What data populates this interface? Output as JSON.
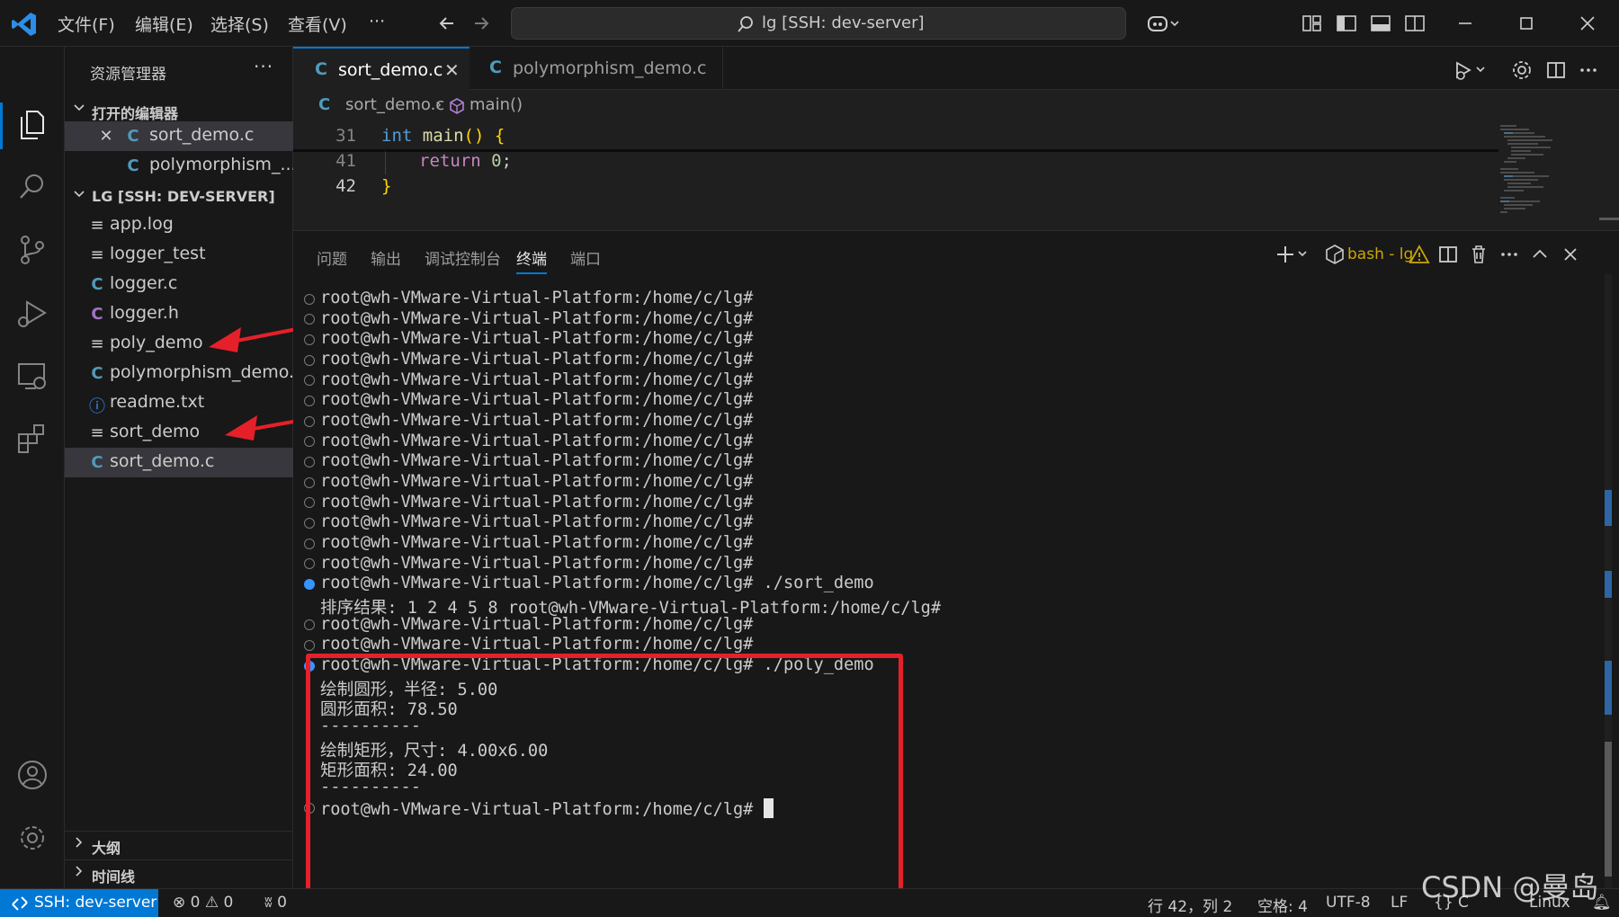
{
  "titlebar": {
    "menus": [
      "文件(F)",
      "编辑(E)",
      "选择(S)",
      "查看(V)",
      "···"
    ],
    "search_text": "lg [SSH: dev-server]"
  },
  "sidebar": {
    "title": "资源管理器",
    "more": "···",
    "open_editors_header": "打开的编辑器",
    "open_editors": [
      {
        "name": "sort_demo.c",
        "icon": "C",
        "close": "✕"
      },
      {
        "name": "polymorphism_...",
        "icon": "C"
      }
    ],
    "folder_header": "LG [SSH: DEV-SERVER]",
    "files": [
      {
        "name": "app.log",
        "icon": "≡"
      },
      {
        "name": "logger_test",
        "icon": "≡"
      },
      {
        "name": "logger.c",
        "icon": "C"
      },
      {
        "name": "logger.h",
        "icon": "C"
      },
      {
        "name": "poly_demo",
        "icon": "≡"
      },
      {
        "name": "polymorphism_demo.c",
        "icon": "C"
      },
      {
        "name": "readme.txt",
        "icon": "ⓘ"
      },
      {
        "name": "sort_demo",
        "icon": "≡"
      },
      {
        "name": "sort_demo.c",
        "icon": "C"
      }
    ],
    "outline_header": "大纲",
    "timeline_header": "时间线"
  },
  "tabs": [
    {
      "name": "sort_demo.c",
      "icon": "C",
      "close": "✕"
    },
    {
      "name": "polymorphism_demo.c",
      "icon": "C"
    }
  ],
  "breadcrumb": {
    "icon": "C",
    "file": "sort_demo.c",
    "sep": "›",
    "symbol": "main()"
  },
  "code": {
    "lines": [
      {
        "num": "31",
        "parts": {
          "kw": "int",
          "fn": "main",
          "rest": "() {"
        }
      },
      {
        "num": "41",
        "parts": {
          "ctl": "return",
          "num": "0",
          "end": ";"
        }
      },
      {
        "num": "42",
        "parts": {
          "br": "}"
        }
      }
    ]
  },
  "panel": {
    "tabs": [
      "问题",
      "输出",
      "调试控制台",
      "终端",
      "端口"
    ],
    "active_tab": "终端",
    "terminal_name": "bash - lg",
    "terminal_lines": [
      "root@wh-VMware-Virtual-Platform:/home/c/lg#",
      "root@wh-VMware-Virtual-Platform:/home/c/lg#",
      "root@wh-VMware-Virtual-Platform:/home/c/lg#",
      "root@wh-VMware-Virtual-Platform:/home/c/lg#",
      "root@wh-VMware-Virtual-Platform:/home/c/lg#",
      "root@wh-VMware-Virtual-Platform:/home/c/lg#",
      "root@wh-VMware-Virtual-Platform:/home/c/lg#",
      "root@wh-VMware-Virtual-Platform:/home/c/lg#",
      "root@wh-VMware-Virtual-Platform:/home/c/lg#",
      "root@wh-VMware-Virtual-Platform:/home/c/lg#",
      "root@wh-VMware-Virtual-Platform:/home/c/lg#",
      "root@wh-VMware-Virtual-Platform:/home/c/lg#",
      "root@wh-VMware-Virtual-Platform:/home/c/lg#",
      "root@wh-VMware-Virtual-Platform:/home/c/lg#",
      "root@wh-VMware-Virtual-Platform:/home/c/lg# ./sort_demo",
      "排序结果: 1 2 4 5 8 root@wh-VMware-Virtual-Platform:/home/c/lg#",
      "root@wh-VMware-Virtual-Platform:/home/c/lg#",
      "root@wh-VMware-Virtual-Platform:/home/c/lg#",
      "root@wh-VMware-Virtual-Platform:/home/c/lg# ./poly_demo",
      "绘制圆形，半径: 5.00",
      "圆形面积: 78.50",
      "----------",
      "绘制矩形，尺寸: 4.00x6.00",
      "矩形面积: 24.00",
      "----------",
      "root@wh-VMware-Virtual-Platform:/home/c/lg#"
    ]
  },
  "status": {
    "remote": "SSH: dev-server",
    "errors": "0",
    "warnings": "0",
    "ports": "0",
    "position": "行 42，列 2",
    "spaces": "空格: 4",
    "encoding": "UTF-8",
    "eol": "LF",
    "language": "C",
    "os": "Linux",
    "watermark": "CSDN @曼岛"
  },
  "colors": {
    "accent": "#0078d4",
    "highlight_box": "#e5202a",
    "arrow": "#e5202a",
    "c_icon": "#519aba"
  }
}
